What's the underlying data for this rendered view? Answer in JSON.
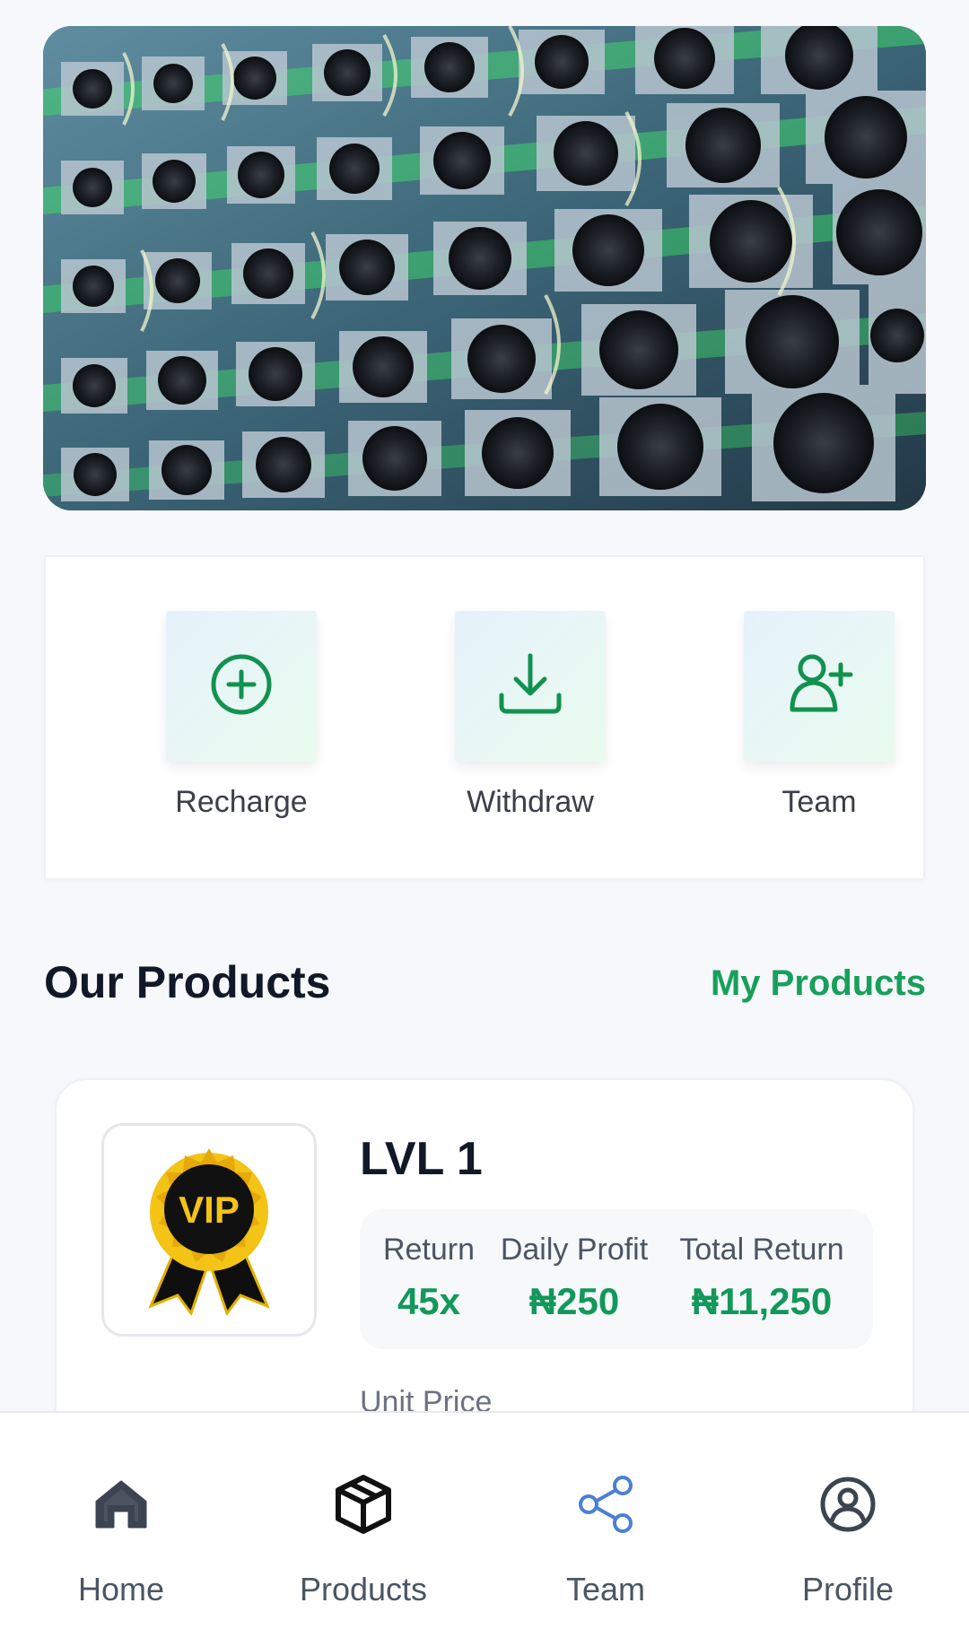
{
  "actions": {
    "recharge_label": "Recharge",
    "withdraw_label": "Withdraw",
    "team_label": "Team"
  },
  "products_section": {
    "title": "Our Products",
    "link": "My Products"
  },
  "product": {
    "badge_text": "VIP",
    "name": "LVL 1",
    "stats": [
      {
        "label": "Return",
        "value": "45x"
      },
      {
        "label": "Daily Profit",
        "value": "₦250"
      },
      {
        "label": "Total Return",
        "value": "₦11,250"
      }
    ],
    "unit_price_label": "Unit Price"
  },
  "nav": {
    "items": [
      {
        "label": "Home",
        "icon": "home-icon"
      },
      {
        "label": "Products",
        "icon": "box-icon"
      },
      {
        "label": "Team",
        "icon": "share-icon"
      },
      {
        "label": "Profile",
        "icon": "user-circle-icon"
      }
    ]
  },
  "colors": {
    "accent_green": "#17a05a",
    "background": "#f6f8fb",
    "team_icon_blue": "#4a7fd6"
  }
}
